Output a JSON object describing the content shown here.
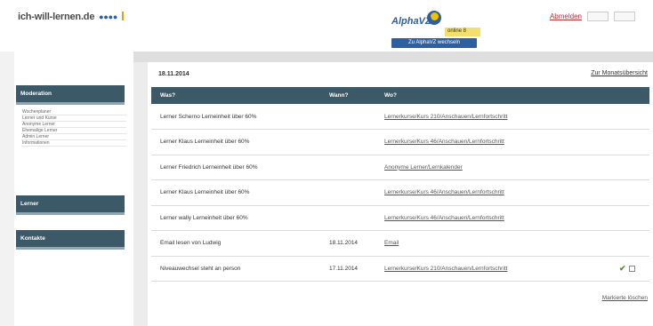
{
  "header": {
    "logo_text": "ich-will-lernen.de",
    "logo_dots": "●●●●",
    "alpha_name": "AlphaVZ",
    "alpha_online": "online 8",
    "alpha_button": "Zu AlphaVZ wechseln",
    "logout_label": "Abmelden"
  },
  "sidebar": {
    "sections": [
      {
        "label": "Moderation"
      },
      {
        "label": "Lerner"
      },
      {
        "label": "Kontakte"
      }
    ],
    "items": [
      {
        "label": "Wochenplaner"
      },
      {
        "label": "Lerner und Kurse"
      },
      {
        "label": "Anonyme Lerner"
      },
      {
        "label": "Ehemalige Lerner"
      },
      {
        "label": "Admin Lerner"
      },
      {
        "label": "Informationen"
      }
    ]
  },
  "main": {
    "date": "18.11.2014",
    "month_link": "Zur Monatsübersicht",
    "columns": [
      "Was?",
      "Wann?",
      "Wo?"
    ],
    "rows": [
      {
        "what": "Lerner Scherno Lerneinheit über 60%",
        "when": "",
        "where": "Lernerkurse/Kurs 210/Anschauen/Lernfortschritt",
        "checked": false
      },
      {
        "what": "Lerner Klaus Lerneinheit über 60%",
        "when": "",
        "where": "Lernerkurse/Kurs 46/Anschauen/Lernfortschritt",
        "checked": false
      },
      {
        "what": "Lerner Friedrich Lerneinheit über 60%",
        "when": "",
        "where": "Anonyme Lerner/Lernkalender",
        "checked": false
      },
      {
        "what": "Lerner Klaus Lerneinheit über 60%",
        "when": "",
        "where": "Lernerkurse/Kurs 46/Anschauen/Lernfortschritt",
        "checked": false
      },
      {
        "what": "Lerner wally Lerneinheit über 60%",
        "when": "",
        "where": "Lernerkurse/Kurs 46/Anschauen/Lernfortschritt",
        "checked": false
      },
      {
        "what": "Email lesen von Ludwig",
        "when": "18.11.2014",
        "where": "Email",
        "checked": false
      },
      {
        "what": "Niveauwechsel steht an person",
        "when": "17.11.2014",
        "where": "Lernerkurse/Kurs 210/Anschauen/Lernfortschritt",
        "checked": true
      }
    ],
    "check_mark": "✔",
    "delete_marked": "Markierte löschen"
  }
}
